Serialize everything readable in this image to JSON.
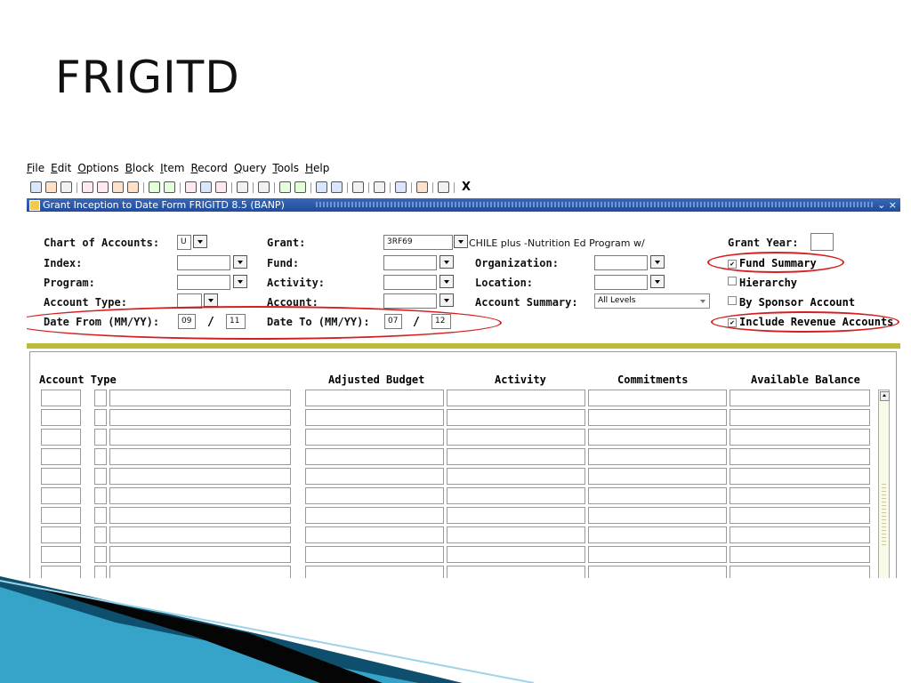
{
  "slide": {
    "title": "FRIGITD"
  },
  "menu": [
    "File",
    "Edit",
    "Options",
    "Block",
    "Item",
    "Record",
    "Query",
    "Tools",
    "Help"
  ],
  "toolbar": {
    "exit_label": "X"
  },
  "window": {
    "title": "Grant Inception to Date Form  FRIGITD  8.5  (BANP)",
    "controls": "⌄ ×"
  },
  "form": {
    "chart_label": "Chart of Accounts:",
    "chart_value": "U",
    "index_label": "Index:",
    "program_label": "Program:",
    "account_type_label": "Account Type:",
    "date_from_label": "Date From (MM/YY):",
    "date_from_month": "09",
    "date_from_year": "11",
    "grant_label": "Grant:",
    "grant_value": "3RF69",
    "grant_desc": "CHILE plus -Nutrition Ed Program w/",
    "fund_label": "Fund:",
    "activity_label": "Activity:",
    "account_label": "Account:",
    "date_to_label": "Date To (MM/YY):",
    "date_to_month": "07",
    "date_to_year": "12",
    "organization_label": "Organization:",
    "location_label": "Location:",
    "account_summary_label": "Account Summary:",
    "account_summary_value": "All Levels",
    "grant_year_label": "Grant Year:",
    "slash": "/"
  },
  "options": {
    "fund_summary": {
      "label": "Fund Summary",
      "mark": "✔"
    },
    "hierarchy": {
      "label": "Hierarchy",
      "mark": ""
    },
    "by_sponsor": {
      "label": "By Sponsor Account",
      "mark": ""
    },
    "include_revenue": {
      "label": "Include Revenue Accounts",
      "mark": "✔"
    }
  },
  "table": {
    "columns": [
      "Account Type",
      "Adjusted Budget",
      "Activity",
      "Commitments",
      "Available Balance"
    ]
  }
}
